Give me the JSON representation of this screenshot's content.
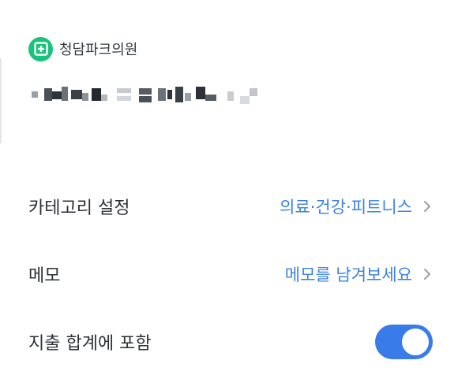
{
  "merchant": {
    "icon": "plus-square-icon",
    "name": "청담파크의원"
  },
  "settings": {
    "category": {
      "label": "카테고리 설정",
      "value": "의료·건강·피트니스",
      "icon": "chevron-right-icon"
    },
    "memo": {
      "label": "메모",
      "value": "메모를 남겨보세요",
      "icon": "chevron-right-icon"
    },
    "include_in_total": {
      "label": "지출 합계에 포함",
      "toggle_on": true
    }
  },
  "colors": {
    "accent": "#3b82e0",
    "toggle": "#3a7bea",
    "merchant_icon": "#19c27d"
  }
}
